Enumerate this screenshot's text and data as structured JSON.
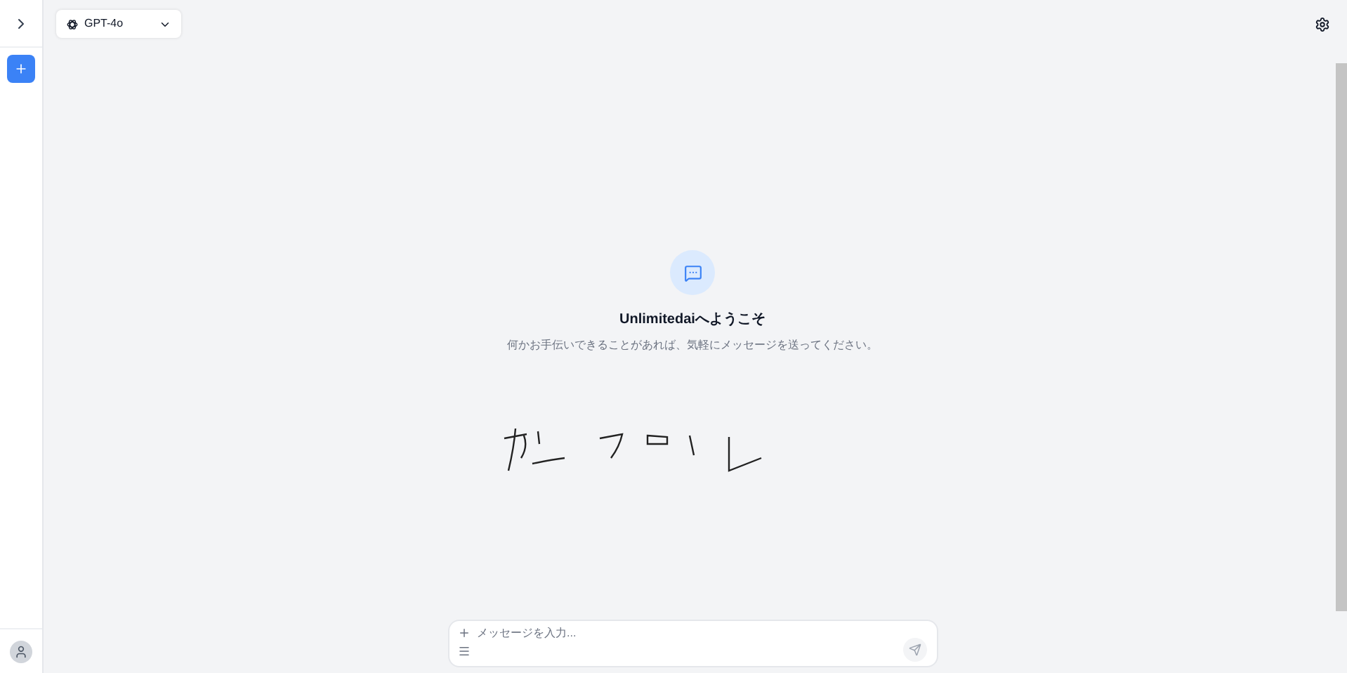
{
  "model_select": {
    "value": "GPT-4o"
  },
  "welcome": {
    "title": "Unlimitedaiへようこそ",
    "subtitle": "何かお手伝いできることがあれば、気軽にメッセージを送ってください。"
  },
  "composer": {
    "placeholder": "メッセージを入力..."
  }
}
